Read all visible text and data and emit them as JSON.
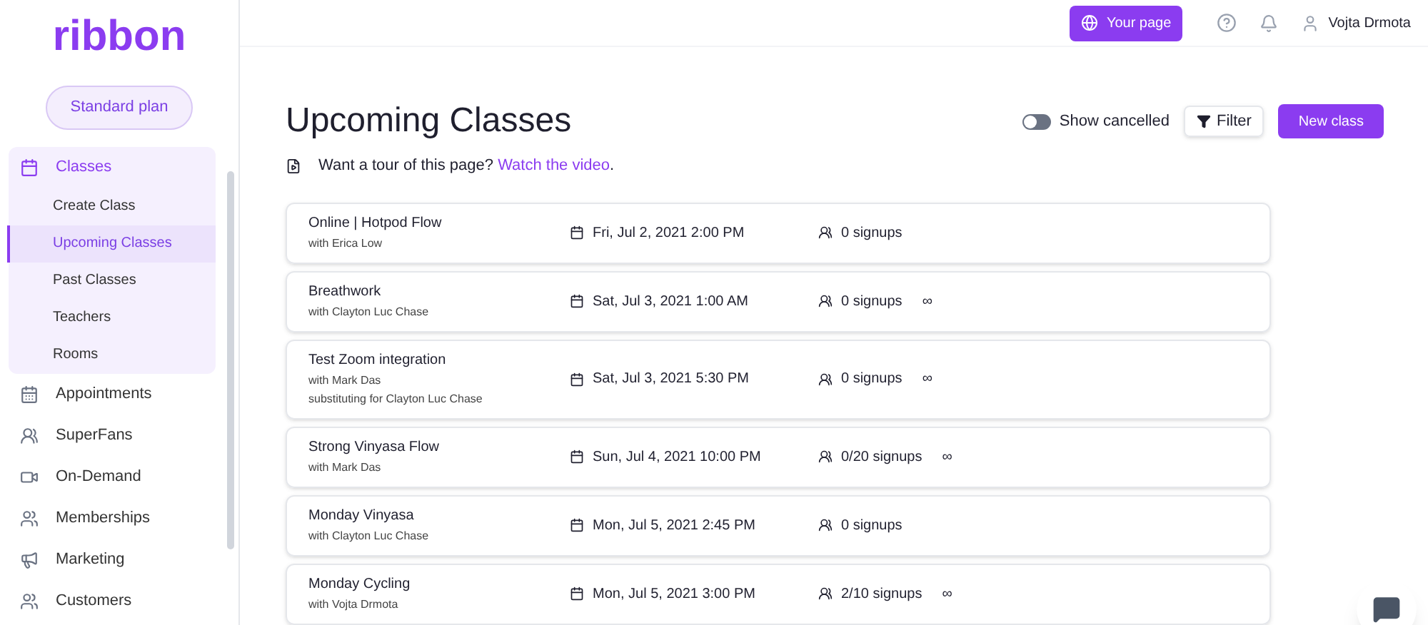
{
  "logo": "ribbon",
  "plan": "Standard plan",
  "sidebar": {
    "items": [
      {
        "label": "Classes",
        "expanded": true,
        "children": [
          {
            "label": "Create Class",
            "selected": false
          },
          {
            "label": "Upcoming Classes",
            "selected": true
          },
          {
            "label": "Past Classes",
            "selected": false
          },
          {
            "label": "Teachers",
            "selected": false
          },
          {
            "label": "Rooms",
            "selected": false
          }
        ]
      },
      {
        "label": "Appointments",
        "expanded": false
      },
      {
        "label": "SuperFans",
        "expanded": false
      },
      {
        "label": "On-Demand",
        "expanded": false
      },
      {
        "label": "Memberships",
        "expanded": false
      },
      {
        "label": "Marketing",
        "expanded": false
      },
      {
        "label": "Customers",
        "expanded": false
      }
    ]
  },
  "topbar": {
    "page_button": "Your page",
    "user": "Vojta Drmota"
  },
  "title": "Upcoming Classes",
  "show_cancelled": {
    "label": "Show cancelled",
    "on": false
  },
  "filter": "Filter",
  "new_class": "New class",
  "tour": {
    "text": "Want a tour of this page?",
    "link": "Watch the video",
    "end": "."
  },
  "classes": [
    {
      "name": "Online | Hotpod Flow",
      "details": [
        "with Erica Low"
      ],
      "date": "Fri, Jul 2, 2021 2:00 PM",
      "signups": "0 signups"
    },
    {
      "name": "Breathwork",
      "details": [
        "with Clayton Luc Chase"
      ],
      "date": "Sat, Jul 3, 2021 1:00 AM",
      "signups": "0 signups",
      "mark": "∞"
    },
    {
      "name": "Test Zoom integration",
      "details": [
        "with Mark Das",
        "substituting for Clayton Luc Chase"
      ],
      "date": "Sat, Jul 3, 2021 5:30 PM",
      "signups": "0 signups",
      "mark": "∞"
    },
    {
      "name": "Strong Vinyasa Flow",
      "details": [
        "with Mark Das"
      ],
      "date": "Sun, Jul 4, 2021 10:00 PM",
      "signups": "0/20 signups",
      "mark": "∞"
    },
    {
      "name": "Monday Vinyasa",
      "details": [
        "with Clayton Luc Chase"
      ],
      "date": "Mon, Jul 5, 2021 2:45 PM",
      "signups": "0 signups"
    },
    {
      "name": "Monday Cycling",
      "details": [
        "with Vojta Drmota"
      ],
      "date": "Mon, Jul 5, 2021 3:00 PM",
      "signups": "2/10 signups",
      "mark": "∞"
    }
  ]
}
